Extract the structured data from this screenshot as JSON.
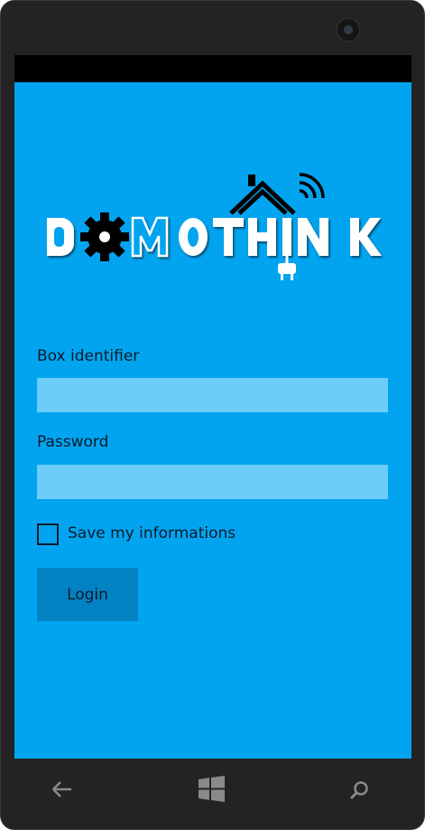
{
  "app": {
    "logo_text": "DOMOTHINK"
  },
  "form": {
    "box_identifier_label": "Box identifier",
    "box_identifier_value": "",
    "password_label": "Password",
    "password_value": "",
    "save_label": "Save my informations",
    "save_checked": false,
    "login_label": "Login"
  },
  "nav": {
    "icons": [
      "back-icon",
      "windows-start-icon",
      "search-icon"
    ]
  },
  "colors": {
    "screen_bg": "#03a4ef",
    "input_bg": "#6ccdf9",
    "button_bg": "#0382c3",
    "phone_frame": "#232323",
    "text": "#0d1b2a"
  }
}
